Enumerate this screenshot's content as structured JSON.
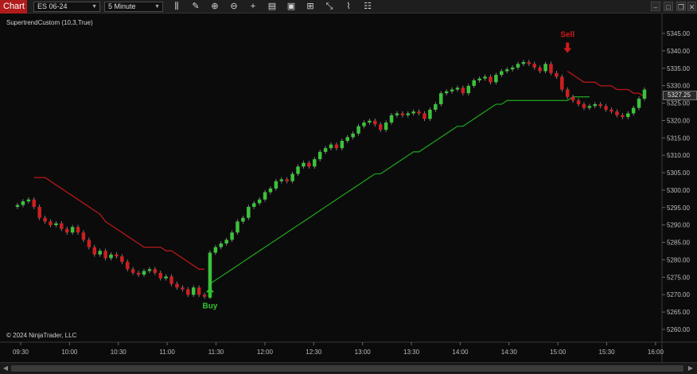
{
  "toolbar": {
    "tab_label": "Chart",
    "instrument": "ES 06-24",
    "interval": "5 Minute",
    "icons": [
      "bar-type-icon",
      "draw-tool-icon",
      "zoom-in-icon",
      "zoom-out-icon",
      "crosshair-icon",
      "data-box-icon",
      "chart-trader-icon",
      "template-icon",
      "strategies-icon",
      "indicators-icon",
      "properties-icon"
    ],
    "window_controls": [
      "minimize",
      "maximize",
      "close"
    ]
  },
  "chart": {
    "indicator_label": "SupertrendCustom (10,3,True)",
    "copyright": "© 2024 NinjaTrader, LLC",
    "current_price": "5327.25",
    "buy_label": "Buy",
    "sell_label": "Sell",
    "colors": {
      "background": "#0b0b0b",
      "up_candle": "#3cc23c",
      "down_candle": "#cc2020",
      "supertrend_down": "#b81818",
      "supertrend_up": "#1f9a1f",
      "buy": "#2fc52f",
      "sell": "#d11a1a"
    },
    "y_labels": [
      "5345.00",
      "5340.00",
      "5335.00",
      "5330.00",
      "5325.00",
      "5320.00",
      "5315.00",
      "5310.00",
      "5305.00",
      "5300.00",
      "5295.00",
      "5290.00",
      "5285.00",
      "5280.00",
      "5275.00",
      "5270.00",
      "5265.00",
      "5260.00"
    ],
    "x_labels": [
      "09:30",
      "10:00",
      "10:30",
      "11:00",
      "11:30",
      "12:00",
      "12:30",
      "13:00",
      "13:30",
      "14:00",
      "14:30",
      "15:00",
      "15:30",
      "16:00"
    ]
  },
  "chart_data": {
    "type": "candlestick",
    "title": "",
    "xlabel": "",
    "ylabel": "",
    "ylim": [
      5258,
      5347
    ],
    "x_start": "09:30",
    "x_end": "16:00",
    "bar_interval_minutes": 5,
    "grid": false,
    "closes": [
      5296.5,
      5297.5,
      5298,
      5296,
      5293,
      5292,
      5291,
      5291.5,
      5290,
      5289,
      5290.5,
      5289,
      5287,
      5285,
      5283,
      5284,
      5282,
      5283,
      5282.5,
      5281,
      5279,
      5278,
      5277.5,
      5278.5,
      5279,
      5278,
      5276.5,
      5277,
      5275,
      5274,
      5273.5,
      5272,
      5274,
      5272,
      5271.5,
      5283.5,
      5285,
      5286,
      5287,
      5289,
      5292,
      5293,
      5296,
      5297,
      5298,
      5300,
      5301,
      5303,
      5303.5,
      5303,
      5305,
      5307,
      5308,
      5307,
      5309,
      5311,
      5312,
      5313,
      5312,
      5314,
      5315,
      5316,
      5318,
      5319,
      5319.5,
      5318.5,
      5317,
      5319,
      5321,
      5321.5,
      5321,
      5321.5,
      5322,
      5321.5,
      5320,
      5322.5,
      5324,
      5327,
      5327.5,
      5328,
      5328.5,
      5327,
      5329,
      5330.5,
      5331,
      5331.5,
      5330,
      5332,
      5333,
      5333.5,
      5334,
      5335,
      5335.5,
      5335,
      5334,
      5333,
      5335,
      5332.5,
      5331.5,
      5328,
      5326,
      5325,
      5324,
      5323,
      5323.5,
      5324,
      5323.5,
      5322.5,
      5322,
      5321,
      5320.5,
      5321.5,
      5323,
      5325.5,
      5328
    ],
    "supertrend_down": [
      null,
      null,
      null,
      5304,
      5304,
      5304,
      5303,
      5302,
      5301,
      5300,
      5299,
      5298,
      5297,
      5296,
      5295,
      5294,
      5292,
      5291,
      5290,
      5289,
      5288,
      5287,
      5286,
      5285,
      5285,
      5285,
      5285,
      5284,
      5284,
      5283,
      5282,
      5281,
      5280,
      5279,
      5279
    ],
    "supertrend_up": [
      5275,
      5276,
      5277,
      5278,
      5279,
      5280,
      5281,
      5282,
      5283,
      5284,
      5285,
      5286,
      5287,
      5288,
      5289,
      5290,
      5291,
      5292,
      5293,
      5294,
      5295,
      5296,
      5297,
      5298,
      5299,
      5300,
      5301,
      5302,
      5303,
      5304,
      5305,
      5305,
      5306,
      5307,
      5308,
      5309,
      5310,
      5311,
      5311,
      5312,
      5313,
      5314,
      5315,
      5316,
      5317,
      5318,
      5318,
      5319,
      5320,
      5321,
      5322,
      5323,
      5324,
      5324,
      5325,
      5325,
      5325,
      5325,
      5325,
      5325,
      5325,
      5325,
      5325,
      5325,
      5325,
      5325,
      5326,
      5326,
      5326,
      5326
    ],
    "supertrend_down_2": [
      5333,
      5332,
      5331,
      5330,
      5330,
      5330,
      5329,
      5329,
      5329,
      5328,
      5328,
      5328,
      5327,
      5327,
      5326
    ],
    "signals": [
      {
        "label": "Buy",
        "time": "11:30",
        "price": 5274
      },
      {
        "label": "Sell",
        "time": "15:00",
        "price": 5338
      }
    ],
    "last_price": 5327.25
  }
}
